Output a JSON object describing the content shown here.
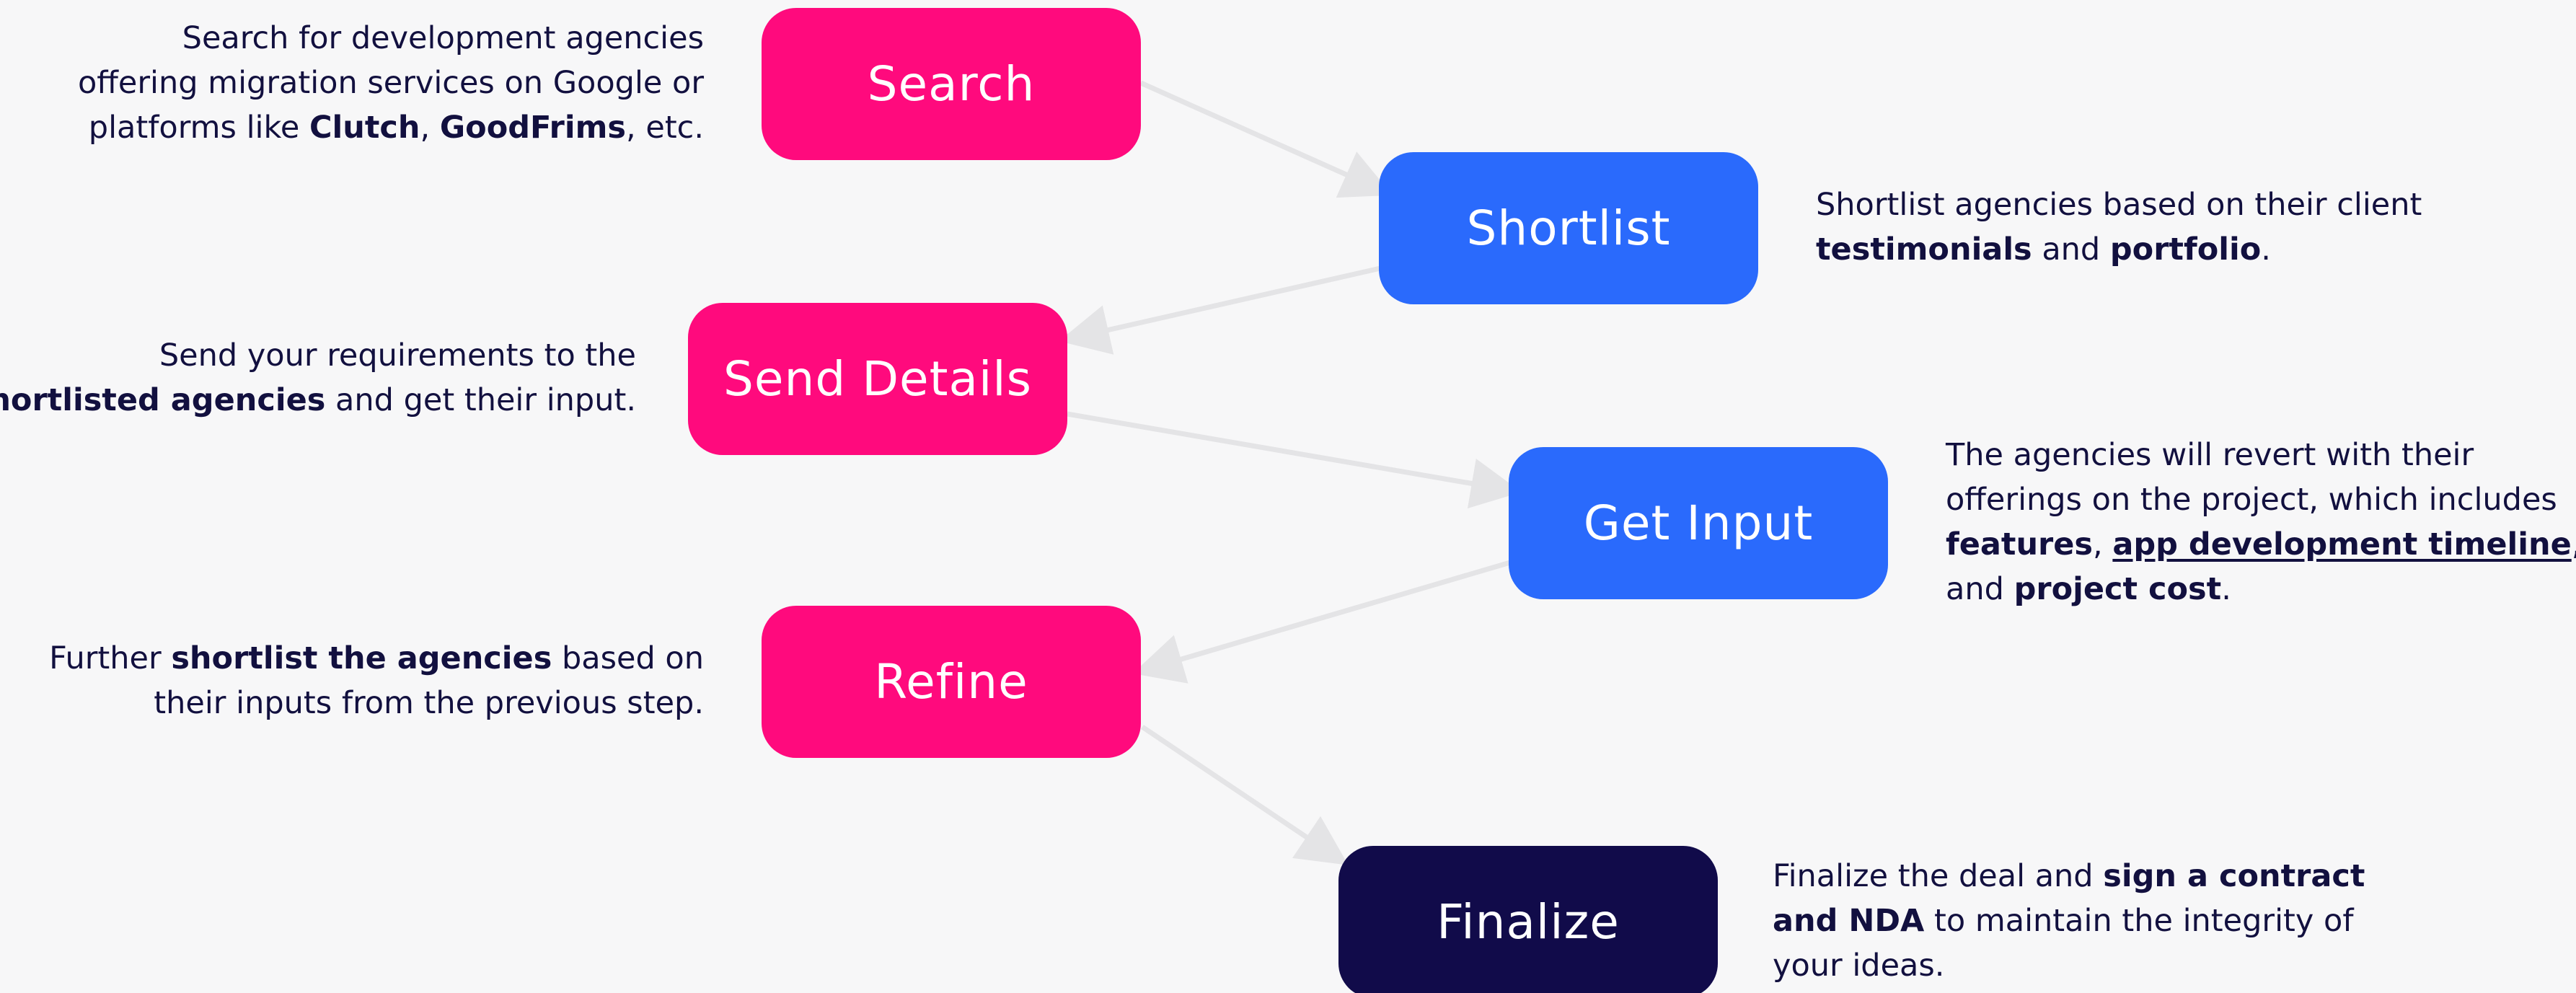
{
  "steps": [
    {
      "id": "search",
      "label": "Search",
      "color": "#ff0a7d"
    },
    {
      "id": "shortlist",
      "label": "Shortlist",
      "color": "#2a6afc"
    },
    {
      "id": "send-details",
      "label": "Send Details",
      "color": "#ff0a7d"
    },
    {
      "id": "get-input",
      "label": "Get Input",
      "color": "#2a6afc"
    },
    {
      "id": "refine",
      "label": "Refine",
      "color": "#ff0a7d"
    },
    {
      "id": "finalize",
      "label": "Finalize",
      "color": "#110b4a"
    }
  ],
  "descriptions": {
    "search": {
      "line1": "Search for development agencies",
      "line2": "offering migration services on Google or",
      "line3_pre": "platforms like ",
      "bold1": "Clutch",
      "sep": ", ",
      "bold2": "GoodFrims",
      "line3_post": ", etc."
    },
    "shortlist": {
      "line1": "Shortlist agencies based on their client",
      "bold1": "testimonials",
      "mid": " and ",
      "bold2": "portfolio",
      "end": "."
    },
    "send_details": {
      "line1": "Send your requirements to the",
      "bold1": "shortlisted agencies",
      "line2_post": " and get their input."
    },
    "get_input": {
      "line1": "The agencies will revert with their",
      "line2": "offerings on the project, which includes",
      "bold1": "features",
      "sep": ", ",
      "link1": "app development timeline",
      "end3": ",",
      "line4_pre": "and ",
      "bold2": "project cost",
      "end4": "."
    },
    "refine": {
      "line1_pre": "Further ",
      "bold1": "shortlist the agencies",
      "line1_post": " based on",
      "line2": "their inputs from the previous step."
    },
    "finalize": {
      "line1_pre": "Finalize the deal and ",
      "bold1": "sign a contract",
      "bold2": "and NDA",
      "line2_post": " to maintain the integrity of",
      "line3": "your ideas."
    }
  },
  "colors": {
    "background": "#f7f7f8",
    "pink": "#ff0a7d",
    "blue": "#2a6afc",
    "navy": "#110b4a",
    "text": "#12103f",
    "arrow": "#e4e4e6"
  }
}
